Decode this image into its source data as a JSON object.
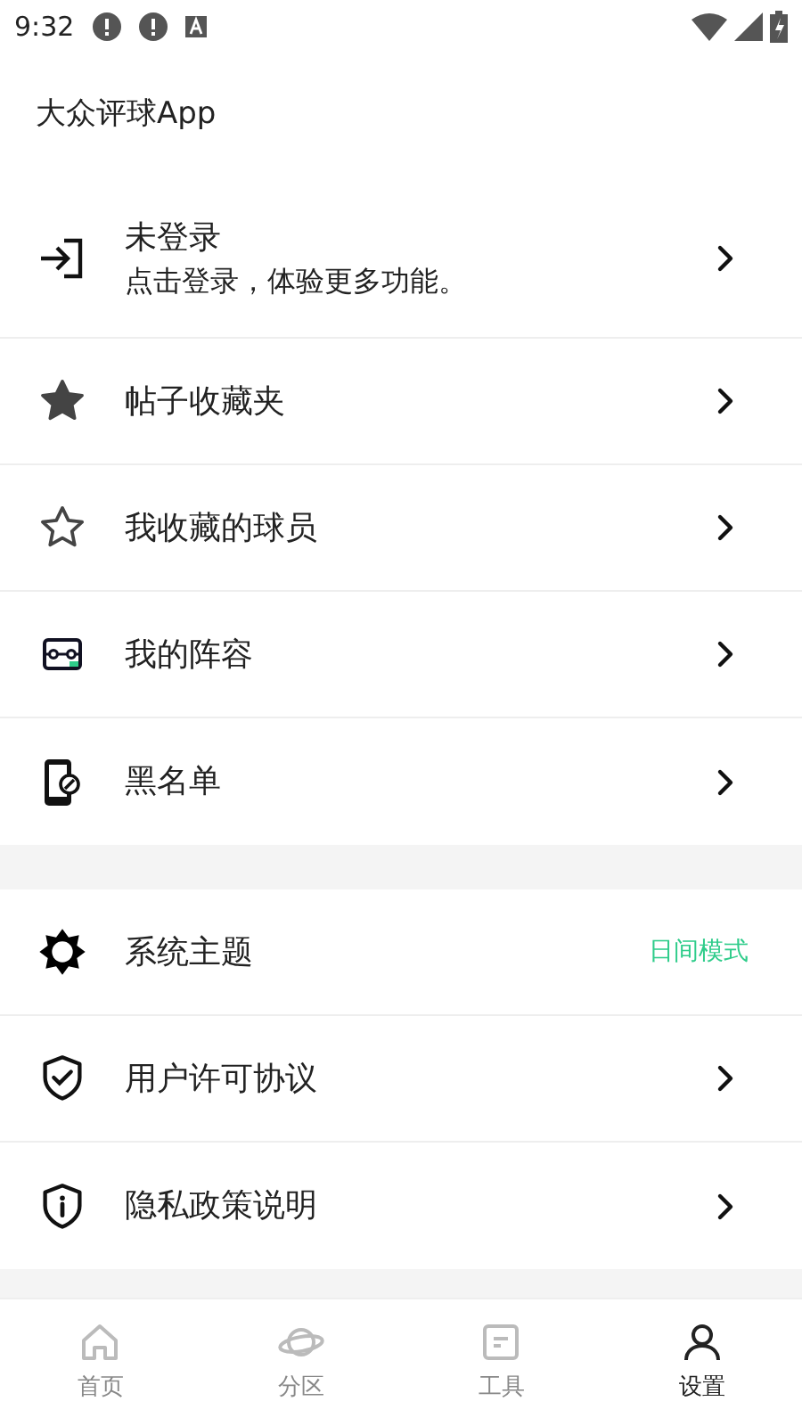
{
  "status_bar": {
    "time": "9:32"
  },
  "header": {
    "title": "大众评球App"
  },
  "login": {
    "title": "未登录",
    "subtitle": "点击登录，体验更多功能。"
  },
  "groups": [
    {
      "items": [
        {
          "kind": "link",
          "label": "帖子收藏夹"
        },
        {
          "kind": "link",
          "label": "我收藏的球员"
        },
        {
          "kind": "link",
          "label": "我的阵容"
        },
        {
          "kind": "link",
          "label": "黑名单"
        }
      ]
    },
    {
      "items": [
        {
          "kind": "value",
          "label": "系统主题",
          "value": "日间模式"
        },
        {
          "kind": "link",
          "label": "用户许可协议"
        },
        {
          "kind": "link",
          "label": "隐私政策说明"
        }
      ]
    }
  ],
  "tabs": [
    {
      "label": "首页",
      "selected": false
    },
    {
      "label": "分区",
      "selected": false
    },
    {
      "label": "工具",
      "selected": false
    },
    {
      "label": "设置",
      "selected": true
    }
  ]
}
